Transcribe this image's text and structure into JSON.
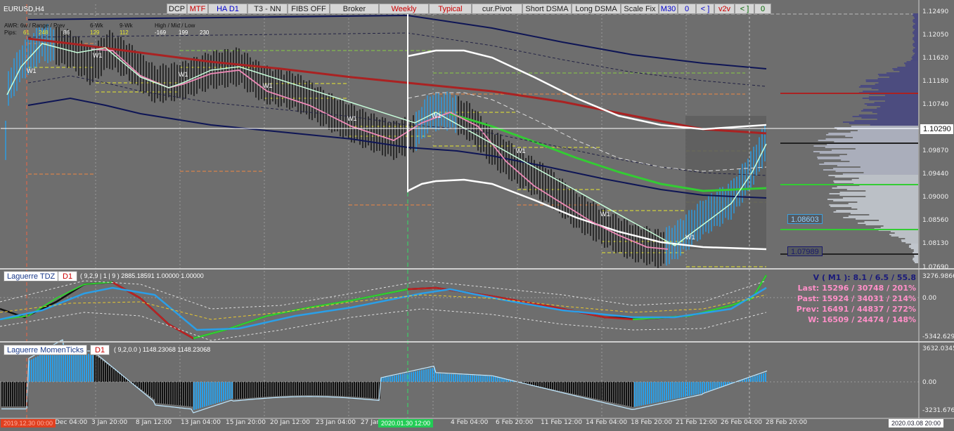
{
  "symbol": "EURUSD,H4",
  "toolbar": [
    {
      "label": "DCP",
      "color": "default"
    },
    {
      "label": "MTF",
      "color": "red"
    },
    {
      "label": "HA D1",
      "color": "blue"
    },
    {
      "label": "T3 - NN",
      "color": "default"
    },
    {
      "label": "FIBS OFF",
      "color": "default"
    },
    {
      "label": "Broker",
      "color": "default"
    },
    {
      "label": "Weekly",
      "color": "red"
    },
    {
      "label": "Typical",
      "color": "red"
    },
    {
      "label": "cur.Pivot",
      "color": "default"
    },
    {
      "label": "Short DSMA",
      "color": "default"
    },
    {
      "label": "Long DSMA",
      "color": "default"
    },
    {
      "label": "Scale Fix",
      "color": "default"
    },
    {
      "label": "M30",
      "color": "blue"
    },
    {
      "label": "0",
      "color": "blue"
    },
    {
      "label": "< ]",
      "color": "blue"
    },
    {
      "label": "v2v",
      "color": "red"
    },
    {
      "label": "< ]",
      "color": "green"
    },
    {
      "label": "0",
      "color": "green"
    }
  ],
  "awr": {
    "line1": "AWR: 6w / Range / Prev",
    "c6wk": "6-Wk",
    "c9wk": "9-Wk",
    "hml": "High / Mid / Low",
    "pips_label": "Pips:",
    "v61": "61",
    "v248": "248",
    "v86": "86",
    "v129": "129",
    "v112": "112",
    "v169": "-169",
    "v199": "199",
    "v230": "230"
  },
  "price_axis": [
    "1.12490",
    "1.12050",
    "1.11620",
    "1.11180",
    "1.10740",
    "1.10290",
    "1.09870",
    "1.09440",
    "1.09000",
    "1.08560",
    "1.08130",
    "1.07690"
  ],
  "price_tags": {
    "current": "1.10290",
    "upper": "1.08603",
    "lower": "1.07989"
  },
  "time_axis": [
    "Dec 04:00",
    "3 Jan 20:00",
    "8 Jan 12:00",
    "13 Jan 04:00",
    "15 Jan 20:00",
    "20 Jan 12:00",
    "23 Jan 04:00",
    "27 Jan",
    "4 Feb 04:00",
    "6 Feb 20:00",
    "11 Feb 12:00",
    "14 Feb 04:00",
    "18 Feb 20:00",
    "21 Feb 12:00",
    "26 Feb 04:00",
    "28 Feb 20:00"
  ],
  "time_markers": {
    "left": "2019.12.30 00:00",
    "cursor": "2020.01.30 12:00",
    "right": "2020.03.08 20:00"
  },
  "w1_labels": [
    "W1",
    "W1",
    "W1",
    "W1",
    "W1",
    "W1",
    "W1",
    "W1",
    "W1",
    "W1"
  ],
  "laguerre_tdz": {
    "name": "Laguerre TDZ",
    "tf": "D1",
    "params": "( 9,2,9 | 1 | 9 ) 2885.18591 1.00000 1.00000",
    "axis": [
      "3276.9866",
      "0.00",
      "-5342.629"
    ],
    "stats": {
      "v": "V ( M1 ): 8.1 / 6.5 / 55.8",
      "last": "Last: 15296 / 30748 / 201%",
      "past": "Past: 15924 / 34031 / 214%",
      "prev": "Prev: 16491 / 44837 / 272%",
      "w": "W: 16509 / 24474 / 148%"
    },
    "colors": {
      "v": "#1a1a7a",
      "stats": "#ff8fc8"
    }
  },
  "laguerre_momen": {
    "name": "Laguerre MomenTicks",
    "tf": "D1",
    "params": "( 9,2,0.0 ) 1148.23068 1148.23068",
    "axis": [
      "3632.0345",
      "0.00",
      "-3231.676"
    ]
  },
  "colors": {
    "bg": "#6e6e6e",
    "blue": "#2a9fe8",
    "pink": "#f08ab8",
    "green": "#33cc33",
    "darkred": "#aa2222",
    "navy": "#0e1555",
    "white": "#ffffff",
    "yellow": "#e8e830"
  }
}
